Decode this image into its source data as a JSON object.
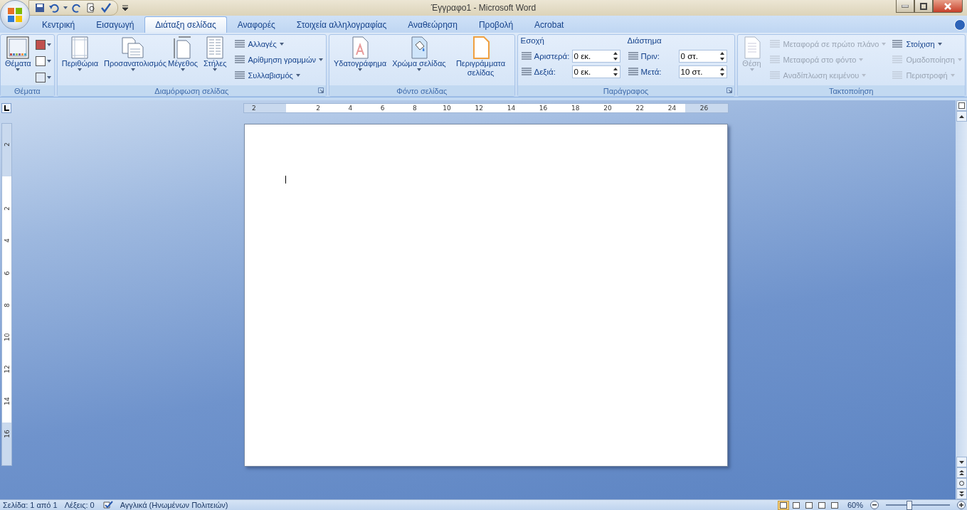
{
  "window": {
    "title": "Έγγραφο1 - Microsoft Word"
  },
  "tabs": [
    {
      "label": "Κεντρική",
      "selected": false
    },
    {
      "label": "Εισαγωγή",
      "selected": false
    },
    {
      "label": "Διάταξη σελίδας",
      "selected": true
    },
    {
      "label": "Αναφορές",
      "selected": false
    },
    {
      "label": "Στοιχεία αλληλογραφίας",
      "selected": false
    },
    {
      "label": "Αναθεώρηση",
      "selected": false
    },
    {
      "label": "Προβολή",
      "selected": false
    },
    {
      "label": "Acrobat",
      "selected": false
    }
  ],
  "ribbon_groups": [
    {
      "label": "Θέματα",
      "launcher": false,
      "columns": [
        {
          "kind": "large",
          "label": "Θέματα",
          "dropdown": true,
          "disabled": false
        },
        {
          "kind": "icons"
        }
      ]
    },
    {
      "label": "Διαμόρφωση σελίδας",
      "launcher": true,
      "columns": [
        {
          "kind": "large",
          "label": "Περιθώρια",
          "dropdown": true,
          "disabled": false
        },
        {
          "kind": "large",
          "label": "Προσανατολισμός",
          "dropdown": true,
          "disabled": false
        },
        {
          "kind": "large",
          "label": "Μέγεθος",
          "dropdown": true,
          "disabled": false
        },
        {
          "kind": "large",
          "label": "Στήλες",
          "dropdown": true,
          "disabled": false
        },
        {
          "kind": "stack",
          "items": [
            {
              "label": "Αλλαγές",
              "dropdown": true,
              "disabled": false
            },
            {
              "label": "Αρίθμηση γραμμών",
              "dropdown": true,
              "disabled": false
            },
            {
              "label": "Συλλαβισμός",
              "dropdown": true,
              "disabled": false
            }
          ]
        }
      ]
    },
    {
      "label": "Φόντο σελίδας",
      "launcher": false,
      "columns": [
        {
          "kind": "large",
          "label": "Υδατογράφημα",
          "dropdown": true,
          "disabled": false
        },
        {
          "kind": "large",
          "label": "Χρώμα σελίδας",
          "dropdown": true,
          "disabled": false
        },
        {
          "kind": "large",
          "label": "Περιγράμματα σελίδας",
          "dropdown": false,
          "disabled": false
        }
      ]
    },
    {
      "label": "Παράγραφος",
      "launcher": true,
      "columns": [
        {
          "kind": "spins",
          "heading": "Εσοχή",
          "items": [
            {
              "label": "Αριστερά:",
              "value": "0 εκ."
            },
            {
              "label": "Δεξιά:",
              "value": "0 εκ."
            }
          ]
        },
        {
          "kind": "spins",
          "heading": "Διάστημα",
          "items": [
            {
              "label": "Πριν:",
              "value": "0 στ."
            },
            {
              "label": "Μετά:",
              "value": "10 στ."
            }
          ]
        }
      ]
    },
    {
      "label": "Τακτοποίηση",
      "launcher": false,
      "columns": [
        {
          "kind": "large",
          "label": "Θέση",
          "dropdown": true,
          "disabled": true
        },
        {
          "kind": "stack",
          "items": [
            {
              "label": "Μεταφορά σε πρώτο πλάνο",
              "dropdown": true,
              "disabled": true
            },
            {
              "label": "Μεταφορά στο φόντο",
              "dropdown": true,
              "disabled": true
            },
            {
              "label": "Αναδίπλωση κειμένου",
              "dropdown": true,
              "disabled": true
            }
          ]
        },
        {
          "kind": "stack",
          "items": [
            {
              "label": "Στοίχιση",
              "dropdown": true,
              "disabled": false
            },
            {
              "label": "Ομαδοποίηση",
              "dropdown": true,
              "disabled": true
            },
            {
              "label": "Περιστροφή",
              "dropdown": true,
              "disabled": true
            }
          ]
        }
      ]
    }
  ],
  "ruler": {
    "labels": [
      "2",
      "2",
      "4",
      "6",
      "8",
      "10",
      "12",
      "14",
      "16",
      "18",
      "20",
      "22",
      "24",
      "26"
    ]
  },
  "vertical_ruler": {
    "labels": [
      "2",
      "2",
      "4",
      "6",
      "8",
      "10",
      "12",
      "14",
      "16"
    ]
  },
  "status_bar": {
    "page": "Σελίδα: 1 από 1",
    "words": "Λέξεις: 0",
    "language": "Αγγλικά (Ηνωμένων Πολιτειών)",
    "views": [
      {
        "selected": true
      },
      {
        "selected": false
      },
      {
        "selected": false
      },
      {
        "selected": false
      },
      {
        "selected": false
      }
    ],
    "zoom": "60%",
    "zoom_slider": {
      "level": 0.37
    }
  }
}
